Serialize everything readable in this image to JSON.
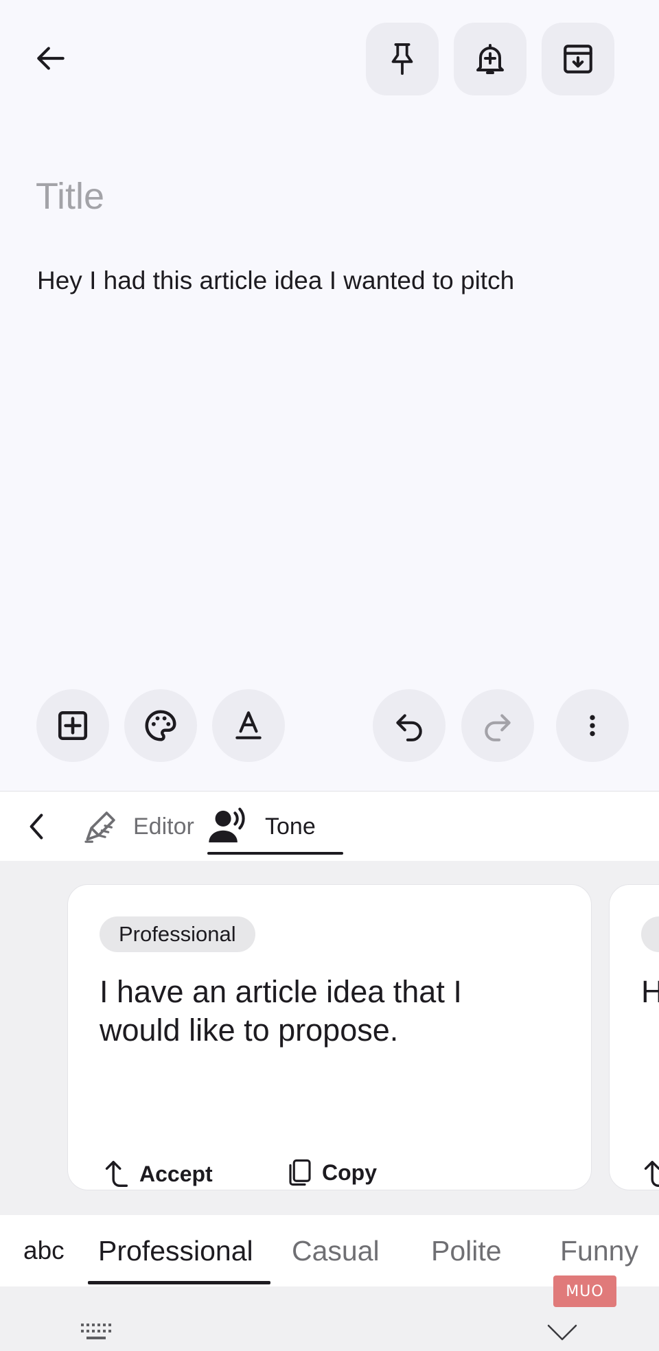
{
  "header": {
    "back_icon": "arrow-left-icon",
    "actions": [
      {
        "name": "pin",
        "icon": "pin-icon"
      },
      {
        "name": "reminder",
        "icon": "bell-plus-icon"
      },
      {
        "name": "archive",
        "icon": "archive-icon"
      }
    ]
  },
  "note": {
    "title_placeholder": "Title",
    "body": "Hey I had this article idea I wanted to pitch"
  },
  "bottom_bar": {
    "left": [
      {
        "name": "add",
        "icon": "add-box-icon"
      },
      {
        "name": "palette",
        "icon": "palette-icon"
      },
      {
        "name": "text-format",
        "icon": "text-format-icon"
      }
    ],
    "right": [
      {
        "name": "undo",
        "icon": "undo-icon"
      },
      {
        "name": "redo",
        "icon": "redo-icon",
        "disabled": true
      },
      {
        "name": "more",
        "icon": "more-vertical-icon"
      }
    ]
  },
  "keyboard_toolbar": {
    "back_icon": "chevron-left-icon",
    "tabs": [
      {
        "label": "Editor",
        "icon": "pen-icon",
        "active": false
      },
      {
        "label": "Tone",
        "icon": "voice-person-icon",
        "active": true
      }
    ]
  },
  "suggestions": {
    "cards": [
      {
        "tone": "Professional",
        "text": "I have an article idea that I would like to propose.",
        "accept_label": "Accept",
        "copy_label": "Copy"
      },
      {
        "tone": "",
        "text": "H id",
        "accept_label": "",
        "copy_label": ""
      }
    ]
  },
  "tone_strip": {
    "items": [
      "abc",
      "Professional",
      "Casual",
      "Polite",
      "Funny"
    ],
    "active": "Professional"
  },
  "nav_bar": {
    "keyboard_icon": "keyboard-icon",
    "collapse_icon": "chevron-down-icon"
  },
  "watermark": "MUO",
  "colors": {
    "background": "#f8f8fd",
    "button_fill": "#ececf2",
    "panel": "#f0f0f2",
    "text": "#1d1b20",
    "muted": "#6f6f73",
    "placeholder": "#a3a3a8"
  }
}
